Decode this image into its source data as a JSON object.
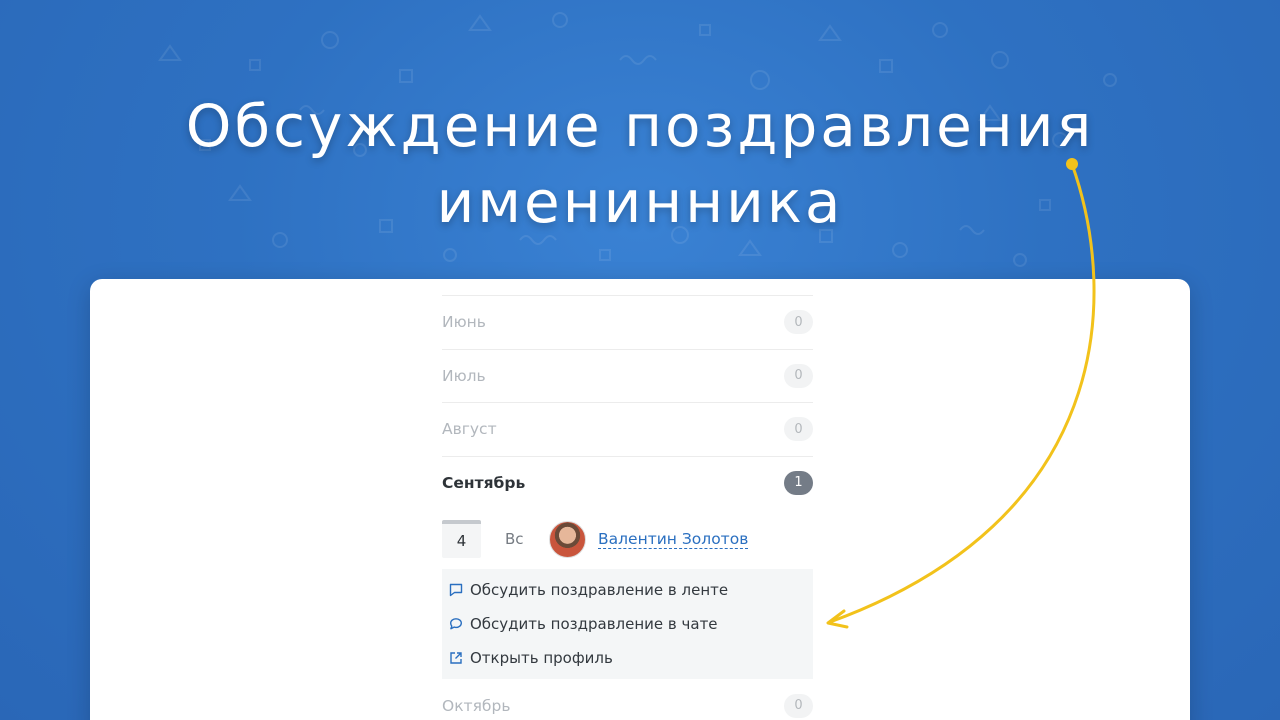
{
  "headline": {
    "line1": "Обсуждение поздравления",
    "line2": "именинника"
  },
  "months": [
    {
      "name": "Июнь",
      "count": "0"
    },
    {
      "name": "Июль",
      "count": "0"
    },
    {
      "name": "Август",
      "count": "0"
    },
    {
      "name": "Сентябрь",
      "count": "1"
    }
  ],
  "birthday": {
    "day": "4",
    "weekday": "Вс",
    "person_name": "Валентин Золотов"
  },
  "actions": {
    "discuss_feed": "Обсудить поздравление в ленте",
    "discuss_chat": "Обсудить поздравление в чате",
    "open_profile": "Открыть профиль"
  },
  "next_month": {
    "name": "Октябрь",
    "count": "0"
  },
  "icons": {
    "feed": "comment-square-icon",
    "chat": "chat-bubble-icon",
    "profile": "external-link-icon"
  },
  "colors": {
    "background": "#2c6dbd",
    "accent_arrow": "#f2c21b",
    "link": "#2a6fc0",
    "active_badge": "#747c87"
  }
}
